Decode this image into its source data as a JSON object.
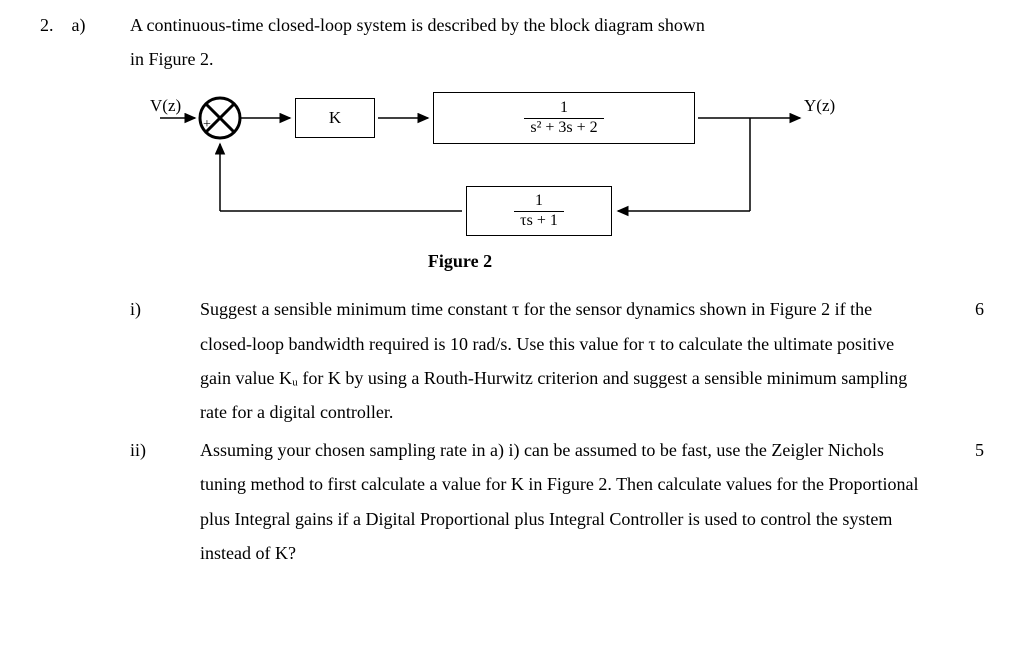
{
  "question_number": "2.",
  "part_label": "a)",
  "intro_line1": "A continuous-time closed-loop system  is described by the block diagram  shown",
  "intro_line2": "in Figure 2.",
  "diagram": {
    "input_label": "V(z)",
    "output_label": "Y(z)",
    "gain_label": "K",
    "plant_num": "1",
    "plant_den": "s² + 3s + 2",
    "sensor_num": "1",
    "sensor_den": "τs + 1",
    "sum_plus": "+",
    "sum_minus": "-",
    "figure_caption": "Figure 2"
  },
  "subparts": [
    {
      "label": "i)",
      "text": "Suggest a sensible minimum time constant τ for the sensor dynamics shown in Figure 2 if the closed-loop bandwidth required is 10 rad/s.   Use this value for τ to calculate the ultimate positive gain value Kᵤ for K by using a Routh-Hurwitz criterion and suggest a sensible minimum sampling rate for a digital controller.",
      "marks": "6"
    },
    {
      "label": "ii)",
      "text": "Assuming your chosen sampling rate in a) i) can be assumed to be fast, use the Zeigler Nichols tuning method to first calculate a value for K in Figure 2.  Then calculate values for the Proportional plus Integral gains if a Digital Proportional plus Integral Controller is used to control the system instead of K?",
      "marks": "5"
    }
  ]
}
